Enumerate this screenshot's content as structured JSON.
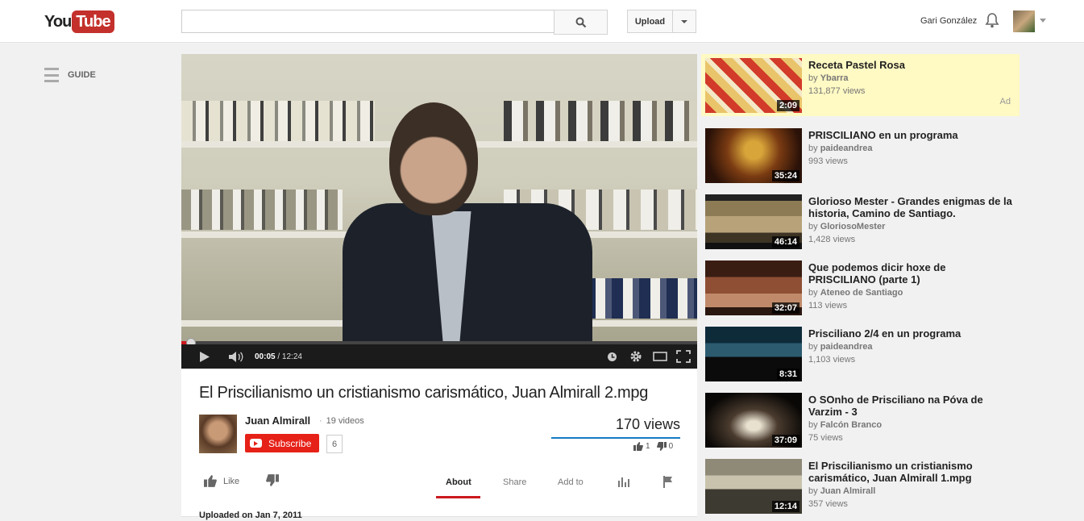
{
  "header": {
    "logo_you": "You",
    "logo_tube": "Tube",
    "search_value": "",
    "upload_label": "Upload",
    "user_name": "Gari González",
    "icons": {
      "search": "magnifier-icon",
      "bell": "bell-icon",
      "menu": "caret-down-icon"
    }
  },
  "guide": {
    "label": "GUIDE"
  },
  "player": {
    "current_time": "00:05",
    "separator": " / ",
    "duration": "12:24",
    "progress": 0.007,
    "icons": [
      "play-icon",
      "volume-icon",
      "watch-later-icon",
      "settings-gear-icon",
      "theater-mode-icon",
      "fullscreen-icon"
    ]
  },
  "video": {
    "title": "El Priscilianismo un cristianismo carismático, Juan Almirall 2.mpg",
    "channel": "Juan Almirall",
    "video_count_label": "19 videos",
    "subscribe_label": "Subscribe",
    "subscriber_count": "6",
    "views": "170 views",
    "likes": "1",
    "dislikes": "0",
    "like_label": "Like",
    "uploaded_label": "Uploaded on Jan 7, 2011"
  },
  "tabs": [
    {
      "label": "About",
      "active": true
    },
    {
      "label": "Share",
      "active": false
    },
    {
      "label": "Add to",
      "active": false
    }
  ],
  "sidebar": {
    "ad_label": "Ad",
    "items": [
      {
        "title": "Receta Pastel Rosa",
        "channel": "Ybarra",
        "views": "131,877 views",
        "duration": "2:09",
        "ad": true
      },
      {
        "title": "PRISCILIANO en un programa",
        "channel": "paideandrea",
        "views": "993 views",
        "duration": "35:24"
      },
      {
        "title": "Glorioso Mester - Grandes enigmas de la historia, Camino de Santiago.",
        "channel": "GloriosoMester",
        "views": "1,428 views",
        "duration": "46:14"
      },
      {
        "title": "Que podemos dicir hoxe de PRISCILIANO (parte 1)",
        "channel": "Ateneo de Santiago",
        "views": "113 views",
        "duration": "32:07"
      },
      {
        "title": "Prisciliano 2/4 en un programa",
        "channel": "paideandrea",
        "views": "1,103 views",
        "duration": "8:31"
      },
      {
        "title": "O SOnho de Prisciliano na Póva de Varzim - 3",
        "channel": "Falcón Branco",
        "views": "75 views",
        "duration": "37:09"
      },
      {
        "title": "El Priscilianismo un cristianismo carismático, Juan Almirall 1.mpg",
        "channel": "Juan Almirall",
        "views": "357 views",
        "duration": "12:14"
      }
    ]
  },
  "by_prefix": "by "
}
